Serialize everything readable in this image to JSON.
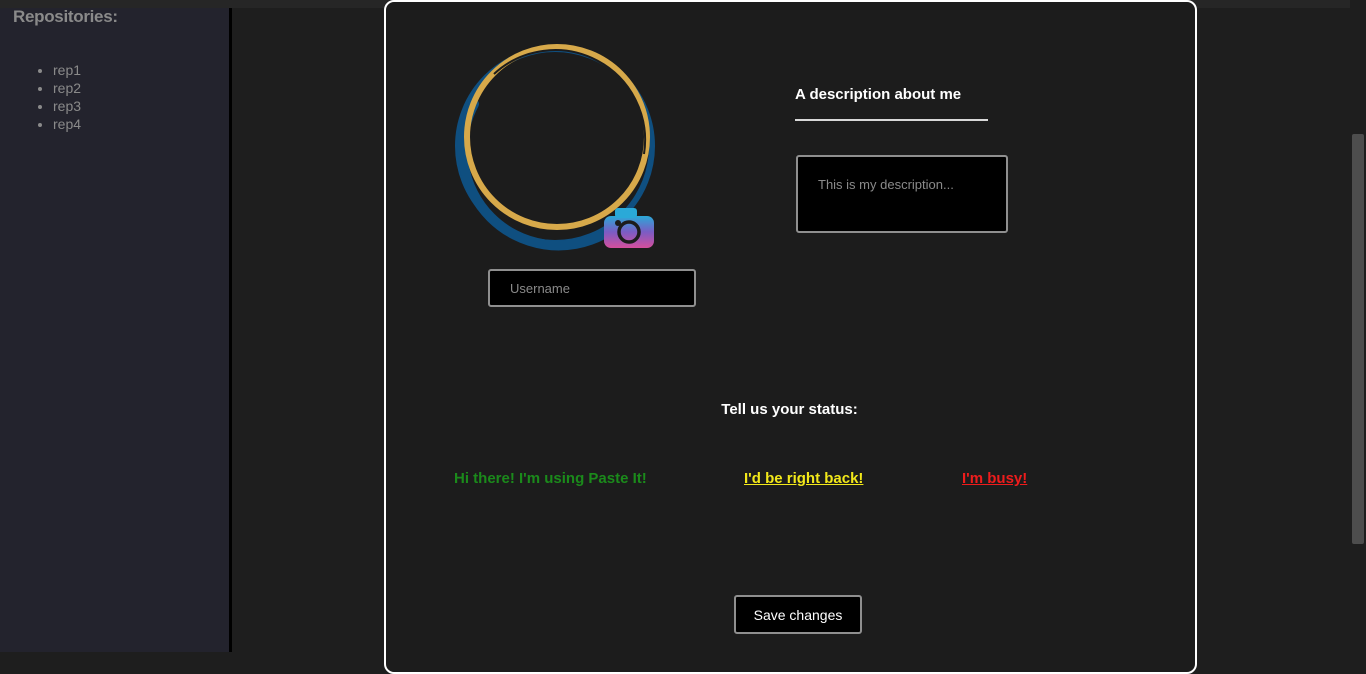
{
  "sidebar": {
    "title": "Repositories:",
    "repos": [
      "rep1",
      "rep2",
      "rep3",
      "rep4"
    ]
  },
  "profile": {
    "avatar_icon": "camera-icon",
    "username_placeholder": "Username",
    "description_heading": "A description about me",
    "description_placeholder": "This is my description..."
  },
  "status": {
    "heading": "Tell us your status:",
    "options": [
      {
        "label": "Hi there! I'm using Paste It!",
        "color": "#1b8a1b"
      },
      {
        "label": "I'd be right back!",
        "color": "#f2e81a"
      },
      {
        "label": "I'm busy!",
        "color": "#ee1c1c"
      }
    ]
  },
  "actions": {
    "save_label": "Save changes"
  },
  "theme": {
    "background": "#1e1e1e",
    "sidebar_background": "#23232d",
    "ring_gold": "#d7a94a",
    "ring_blue": "#0f4f80"
  }
}
